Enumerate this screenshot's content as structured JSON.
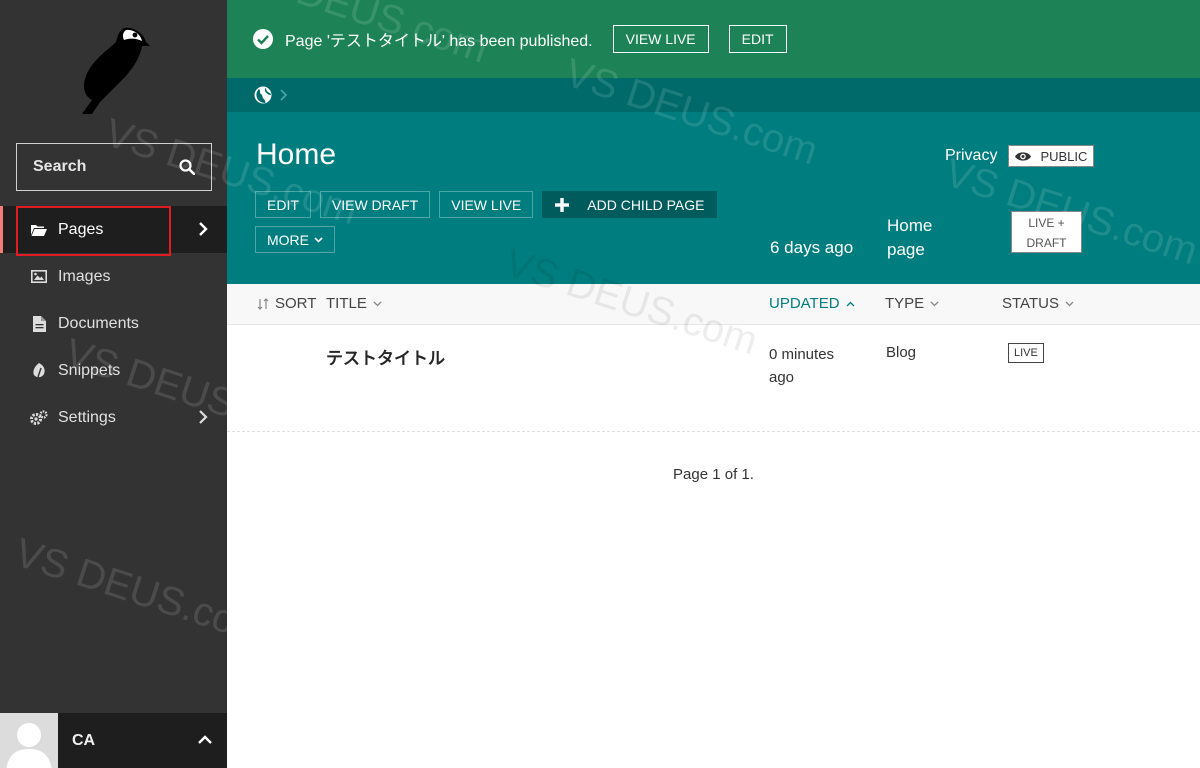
{
  "sidebar": {
    "search_label": "Search",
    "items": [
      {
        "label": "Pages",
        "icon": "folder-open-icon",
        "has_submenu": true,
        "active": true
      },
      {
        "label": "Images",
        "icon": "image-icon",
        "has_submenu": false
      },
      {
        "label": "Documents",
        "icon": "document-icon",
        "has_submenu": false
      },
      {
        "label": "Snippets",
        "icon": "snippet-icon",
        "has_submenu": false
      },
      {
        "label": "Settings",
        "icon": "cogs-icon",
        "has_submenu": true
      }
    ],
    "account_initials": "CA"
  },
  "message": {
    "text": "Page 'テストタイトル' has been published.",
    "view_live": "VIEW LIVE",
    "edit": "EDIT"
  },
  "header": {
    "title": "Home",
    "actions": {
      "edit": "EDIT",
      "view_draft": "VIEW DRAFT",
      "view_live": "VIEW LIVE",
      "add_child": "ADD CHILD PAGE",
      "more": "MORE"
    },
    "updated": "6 days ago",
    "type": "Home page",
    "status_line1": "LIVE +",
    "status_line2": "DRAFT",
    "privacy_label": "Privacy",
    "privacy_value": "PUBLIC"
  },
  "listing": {
    "columns": {
      "sort": "SORT",
      "title": "TITLE",
      "updated": "UPDATED",
      "type": "TYPE",
      "status": "STATUS"
    },
    "rows": [
      {
        "title": "テストタイトル",
        "updated": "0 minutes ago",
        "type": "Blog",
        "status": "LIVE"
      }
    ],
    "pagination": "Page 1 of 1."
  },
  "watermark": "VS DEUS.com",
  "colors": {
    "sidebar": "#333333",
    "success": "#1d8356",
    "teal": "#007d7e",
    "teal_dark": "#006a6a",
    "highlight": "#e01b22"
  }
}
